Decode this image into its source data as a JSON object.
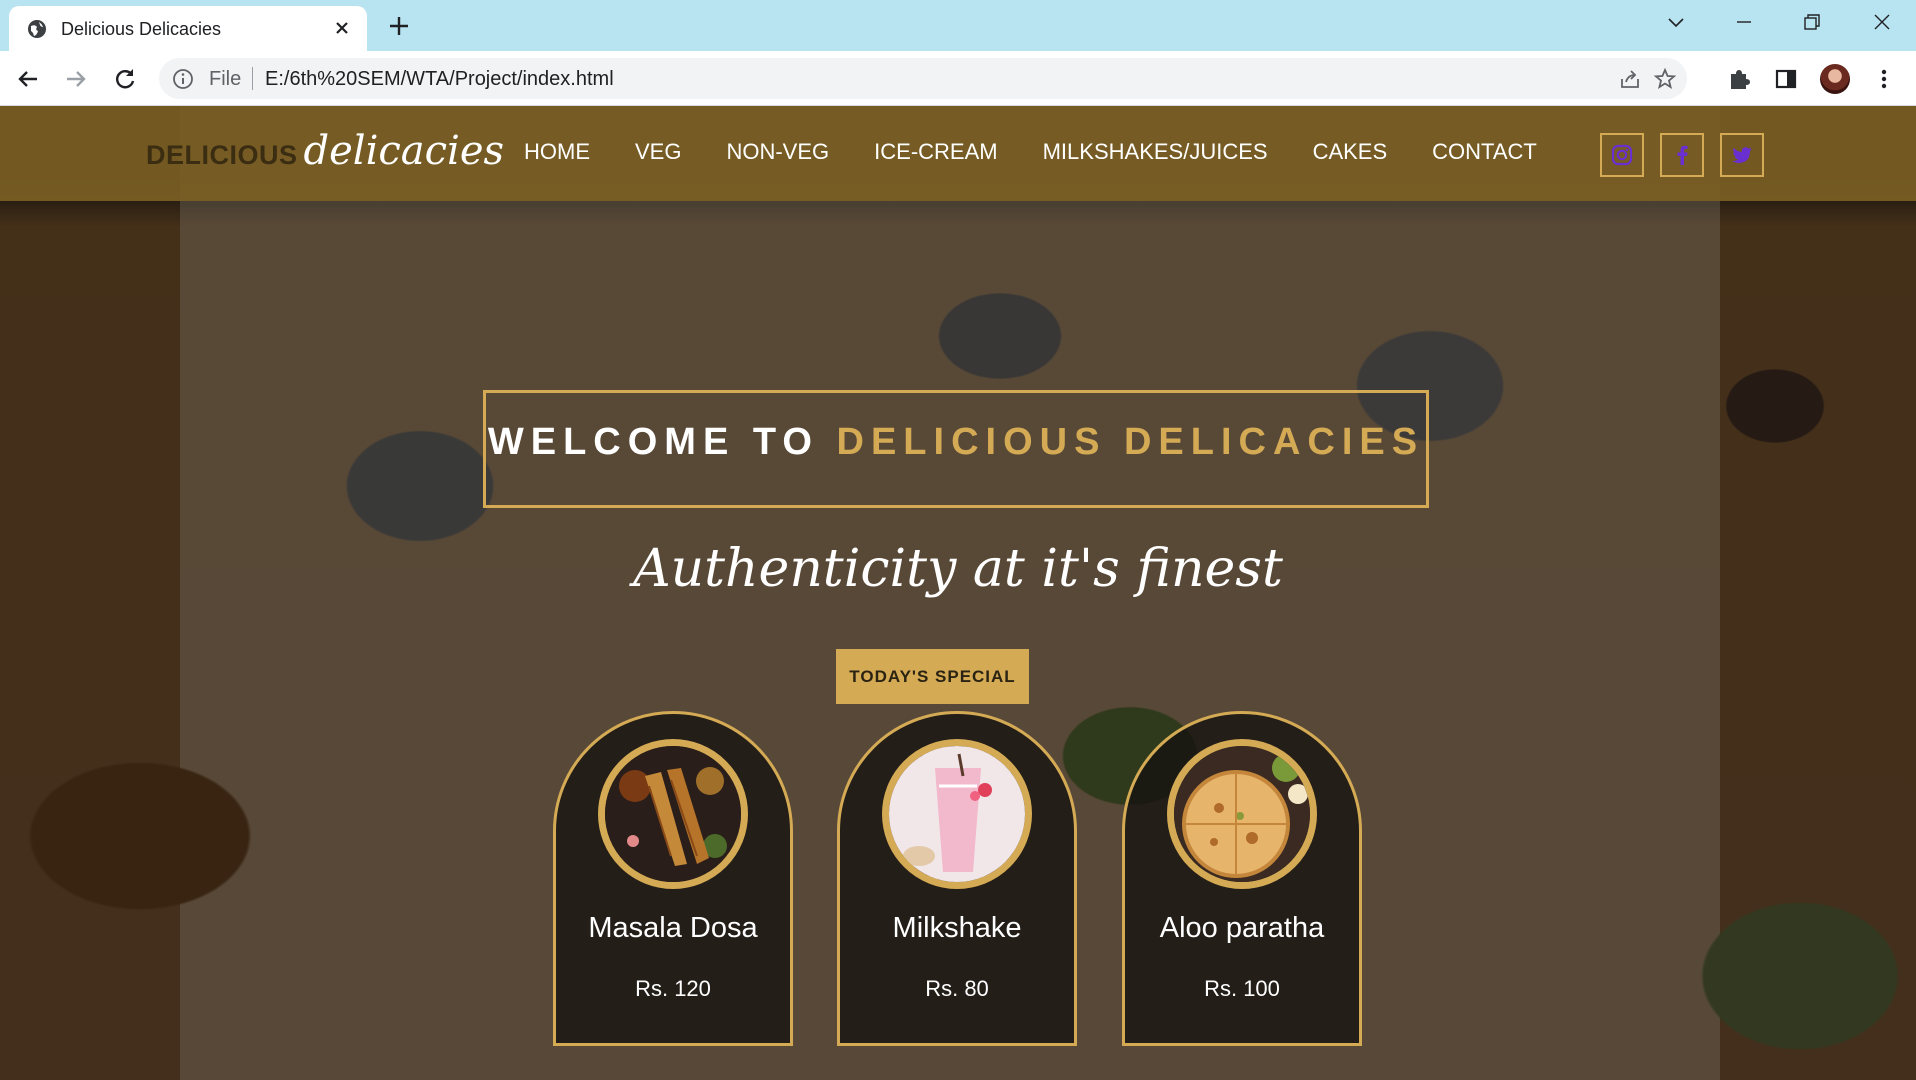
{
  "browser": {
    "tab_title": "Delicious Delicacies",
    "omnibox_scheme": "File",
    "url": "E:/6th%20SEM/WTA/Project/index.html"
  },
  "site": {
    "logo_main": "DELICIOUS",
    "logo_script": "delicacies",
    "nav": [
      "HOME",
      "VEG",
      "NON-VEG",
      "ICE-CREAM",
      "MILKSHAKES/JUICES",
      "CAKES",
      "CONTACT"
    ],
    "social_icons": [
      "instagram-icon",
      "facebook-icon",
      "twitter-icon"
    ]
  },
  "hero": {
    "welcome_prefix": "WELCOME TO",
    "welcome_brand": "DELICIOUS DELICACIES",
    "tagline": "Authenticity at it's finest",
    "special_label": "TODAY'S  SPECIAL"
  },
  "specials": [
    {
      "name": "Masala Dosa",
      "price": "Rs. 120"
    },
    {
      "name": "Milkshake",
      "price": "Rs. 80"
    },
    {
      "name": "Aloo paratha",
      "price": "Rs. 100"
    }
  ],
  "colors": {
    "accent": "#d4aa55",
    "header": "#7c6024",
    "tabbar": "#b8e3f0",
    "social_icon": "#6a2fd0"
  }
}
